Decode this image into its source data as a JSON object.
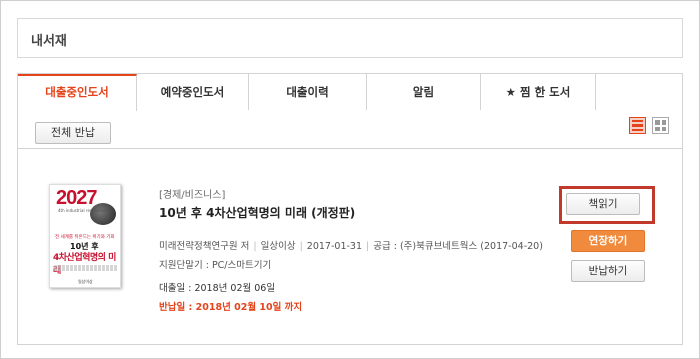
{
  "page": {
    "title": "내서재"
  },
  "tabs": [
    {
      "label": "대출중인도서",
      "active": true
    },
    {
      "label": "예약중인도서",
      "active": false
    },
    {
      "label": "대출이력",
      "active": false
    },
    {
      "label": "알림",
      "active": false
    },
    {
      "label": "★ 찜 한 도서",
      "active": false
    }
  ],
  "toolbar": {
    "return_all_label": "전체 반납",
    "view_icons": [
      "list-view-icon",
      "grid-view-icon"
    ]
  },
  "book": {
    "category": "[경제/비즈니스]",
    "title": "10년 후 4차산업혁명의 미래 (개정판)",
    "author": "미래전략정책연구원 저",
    "age": "일상이상",
    "pub_date": "2017-01-31",
    "supply": "공급 : (주)북큐브네트웍스 (2017-04-20)",
    "device": "지원단말기 : PC/스마트기기",
    "loan_date": "대출일 : 2018년 02월 06일",
    "return_date": "반납일 : 2018년 02월 10일 까지",
    "cover": {
      "year": "2027",
      "subtitle": "4th industrial revolution",
      "tagline": "전 세계를 뒤흔드는 위기와 기회",
      "line1": "10년 후",
      "line2": "4차산업혁명의 미래",
      "publisher": "일상이상"
    }
  },
  "actions": {
    "read_label": "책읽기",
    "extend_label": "연장하기",
    "return_label": "반납하기"
  },
  "colors": {
    "accent": "#e4441b",
    "extend": "#f08a3c",
    "highlight_border": "#c0392b"
  }
}
